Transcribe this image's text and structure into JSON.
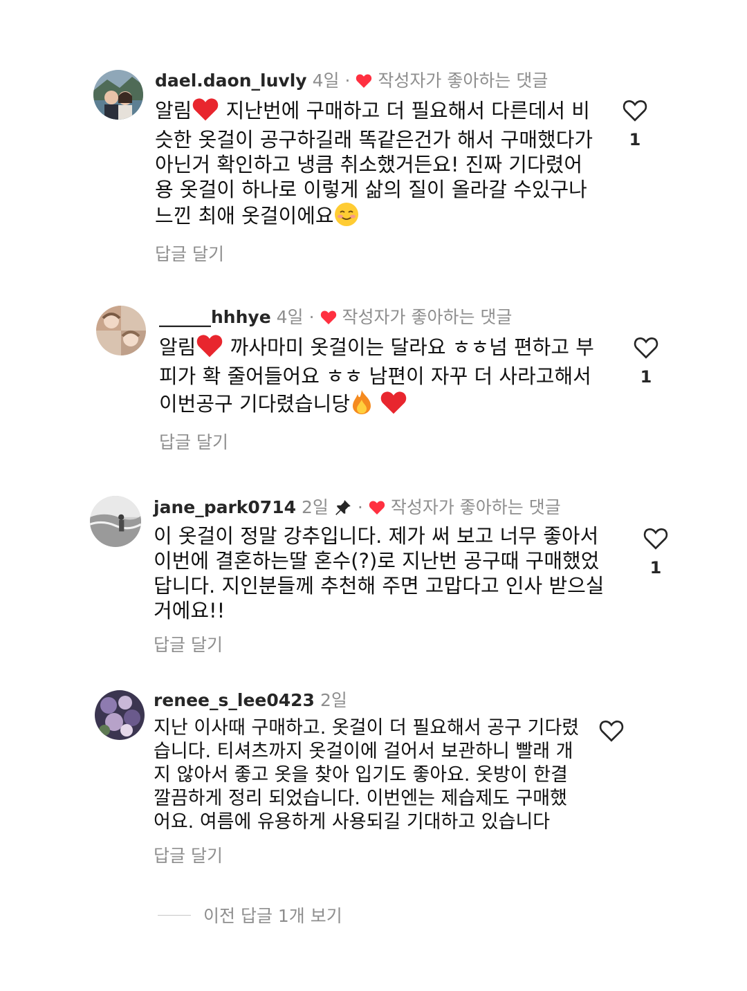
{
  "comments": [
    {
      "username": "dael.daon_luvly",
      "time": "4일",
      "liked_label": "작성자가 좋아하는 댓글",
      "text_prefix": "알림",
      "text": "지난번에 구매하고 더 필요해서 다른데서 비슷한 옷걸이 공구하길래 똑같은건가 해서 구매했다가 아닌거 확인하고 냉큼 취소했거든요! 진짜 기다렸어용 옷걸이 하나로 이렇게 삶의 질이 올라갈 수있구나 느낀 최애 옷걸이에요",
      "reply_label": "답글 달기",
      "like_count": "1"
    },
    {
      "username": "______hhhye",
      "time": "4일",
      "liked_label": "작성자가 좋아하는 댓글",
      "text_prefix": "알림",
      "text": "까사마미 옷걸이는 달라요 ㅎㅎ넘 편하고 부피가 확 줄어들어요 ㅎㅎ 남편이 자꾸 더 사라고해서 이번공구 기다렸습니당",
      "reply_label": "답글 달기",
      "like_count": "1"
    },
    {
      "username": "jane_park0714",
      "time": "2일",
      "liked_label": "작성자가 좋아하는 댓글",
      "text": "이 옷걸이 정말 강추입니다.  제가 써 보고 너무 좋아서 이번에 결혼하는딸 혼수(?)로 지난번 공구때 구매했었답니다.  지인분들께 추천해 주면 고맙다고 인사 받으실거에요!!",
      "reply_label": "답글 달기",
      "like_count": "1"
    },
    {
      "username": "renee_s_lee0423",
      "time": "2일",
      "text": "지난 이사때 구매하고. 옷걸이 더 필요해서 공구 기다렸습니다. 티셔츠까지 옷걸이에 걸어서 보관하니 빨래 개지 않아서 좋고 옷을 찾아 입기도 좋아요. 옷방이 한결 깔끔하게 정리 되었습니다. 이번엔는 제습제도 구매했어요. 여름에 유용하게 사용되길 기대하고 있습니다",
      "reply_label": "답글 달기"
    }
  ],
  "view_previous_replies": "이전 답글 1개 보기",
  "icons": {
    "like": "heart-outline-icon",
    "author_liked": "red-heart-icon",
    "pinned": "pin-icon",
    "emoji_heart": "red-heart-emoji",
    "emoji_smile": "smiling-face-emoji",
    "emoji_fire": "fire-emoji"
  },
  "colors": {
    "meta_gray": "#8e8e8e",
    "heart_red": "#ff3040",
    "text": "#111111"
  }
}
